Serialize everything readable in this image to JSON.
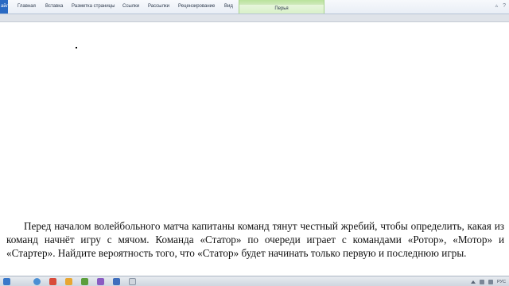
{
  "ribbon": {
    "file_tab": "айл",
    "tabs": [
      {
        "label": "Главная"
      },
      {
        "label": "Вставка"
      },
      {
        "label": "Разметка страницы"
      },
      {
        "label": "Ссылки"
      },
      {
        "label": "Рассылки"
      },
      {
        "label": "Рецензирование"
      },
      {
        "label": "Вид"
      }
    ],
    "context_tab": "Перья",
    "accent_color": "#2a6ac3",
    "context_color": "#d9f0c9"
  },
  "document": {
    "paragraph": "Перед началом волейбольного матча капитаны команд тянут честный жребий, чтобы определить, какая из команд начнёт игру с мячом. Команда «Статор» по очереди играет с командами «Ротор», «Мотор» и «Стартер». Найдите вероятность того, что «Статор» будет начинать только первую и последнюю игры."
  },
  "taskbar": {
    "language": "РУС",
    "app_icons": [
      "explorer-icon",
      "skype-icon",
      "browser-icon",
      "media-icon",
      "folder-icon",
      "word-icon",
      "paint-icon",
      "app-icon"
    ]
  }
}
